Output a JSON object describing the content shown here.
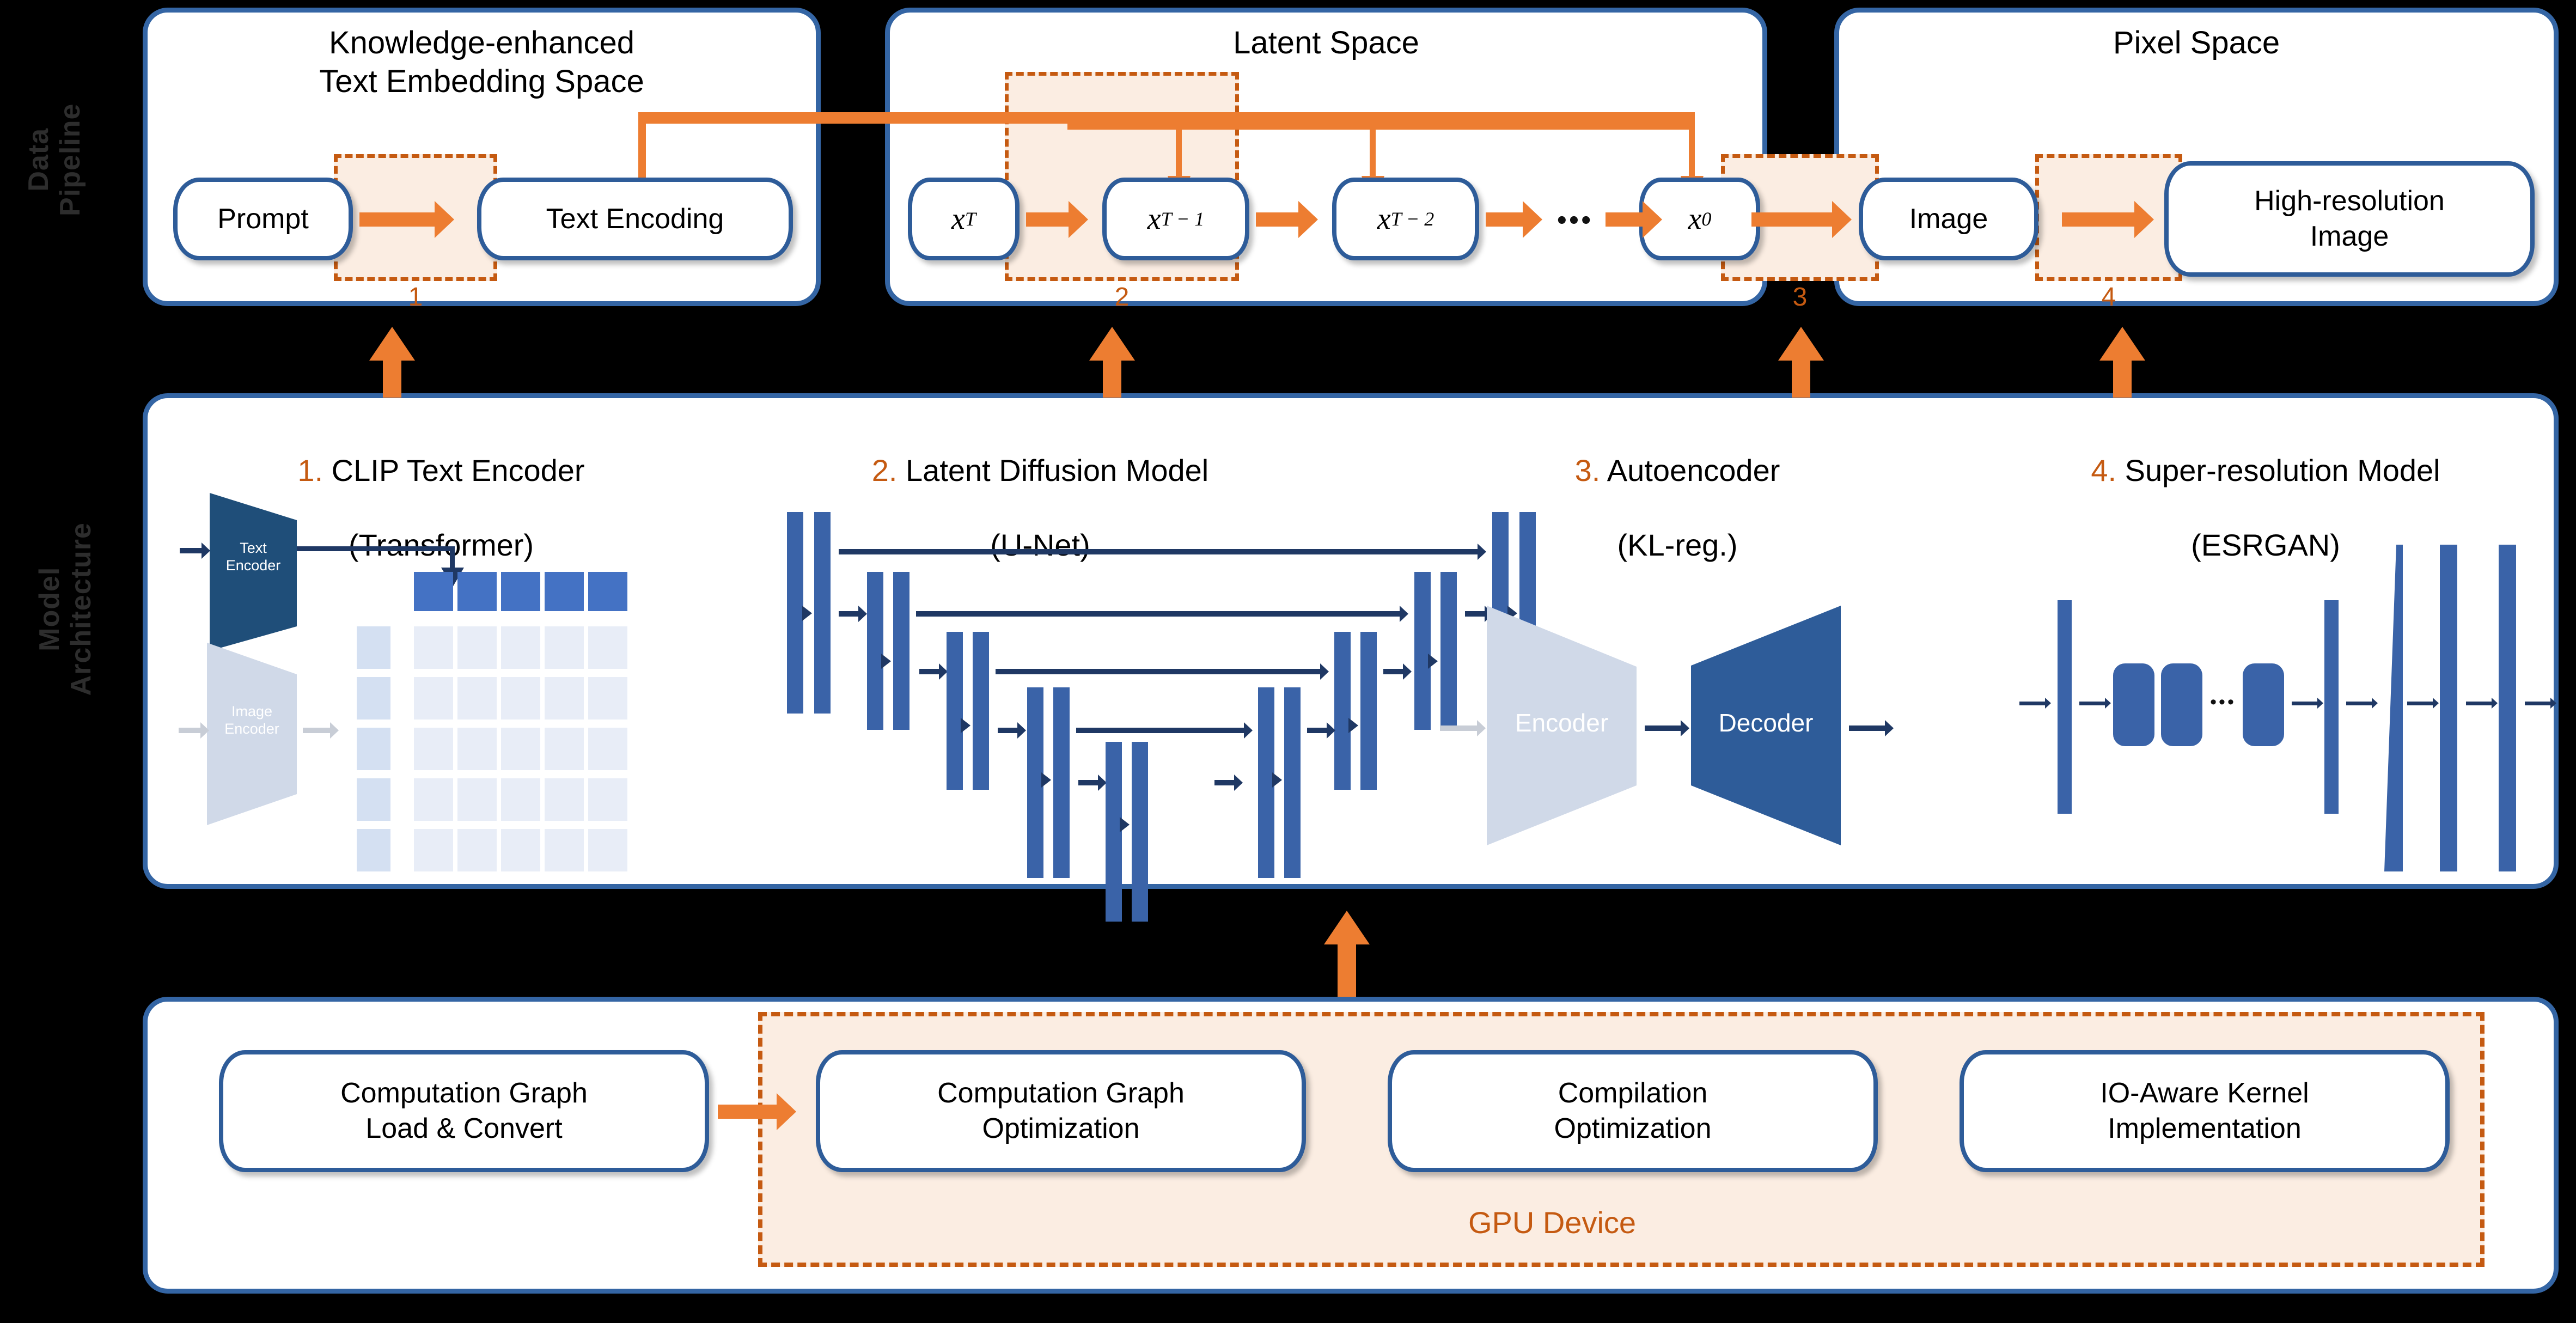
{
  "rows": [
    {
      "label": "Data\nPipeline"
    },
    {
      "label": "Model\nArchitecture"
    }
  ],
  "data_pipeline": {
    "panels": [
      {
        "title": "Knowledge-enhanced\nText Embedding Space",
        "nodes": [
          "Prompt",
          "Text Encoding"
        ]
      },
      {
        "title": "Latent Space",
        "nodes": [
          "x_T",
          "x_T-1",
          "x_T-2",
          "...",
          "x_0"
        ],
        "node_labels": {
          "xT": "T",
          "xT1": "T − 1",
          "xT2": "T − 2",
          "x0": "0",
          "base": "x",
          "ellipsis": "•••"
        }
      },
      {
        "title": "Pixel Space",
        "nodes": [
          "Image",
          "High-resolution\nImage"
        ]
      }
    ],
    "step_markers": [
      "1",
      "2",
      "3",
      "4"
    ]
  },
  "model_architecture": {
    "sections": [
      {
        "num": "1.",
        "title": " CLIP Text Encoder",
        "sub": "(Transformer)",
        "labels": {
          "text_encoder": "Text\nEncoder",
          "image_encoder": "Image\nEncoder"
        }
      },
      {
        "num": "2.",
        "title": " Latent Diffusion Model",
        "sub": "(U-Net)"
      },
      {
        "num": "3.",
        "title": " Autoencoder",
        "sub": "(KL-reg.)",
        "labels": {
          "encoder": "Encoder",
          "decoder": "Decoder"
        }
      },
      {
        "num": "4.",
        "title": " Super-resolution Model",
        "sub": "(ESRGAN)",
        "labels": {
          "ellipsis": "•••"
        }
      }
    ]
  },
  "deployment": {
    "nodes": [
      "Computation Graph\nLoad & Convert",
      "Computation Graph\nOptimization",
      "Compilation\nOptimization",
      "IO-Aware Kernel\nImplementation"
    ],
    "gpu_label": "GPU Device"
  },
  "colors": {
    "panel_border": "#3465A4",
    "node_border": "#2E5C99",
    "accent_orange": "#ED7D31",
    "dash_orange": "#C55A11",
    "highlight_fill": "#FBEDE2",
    "model_blue": "#3A63A8",
    "model_navy": "#1F3864",
    "pale_blue": "#D9E1F1",
    "background": "#000000"
  }
}
